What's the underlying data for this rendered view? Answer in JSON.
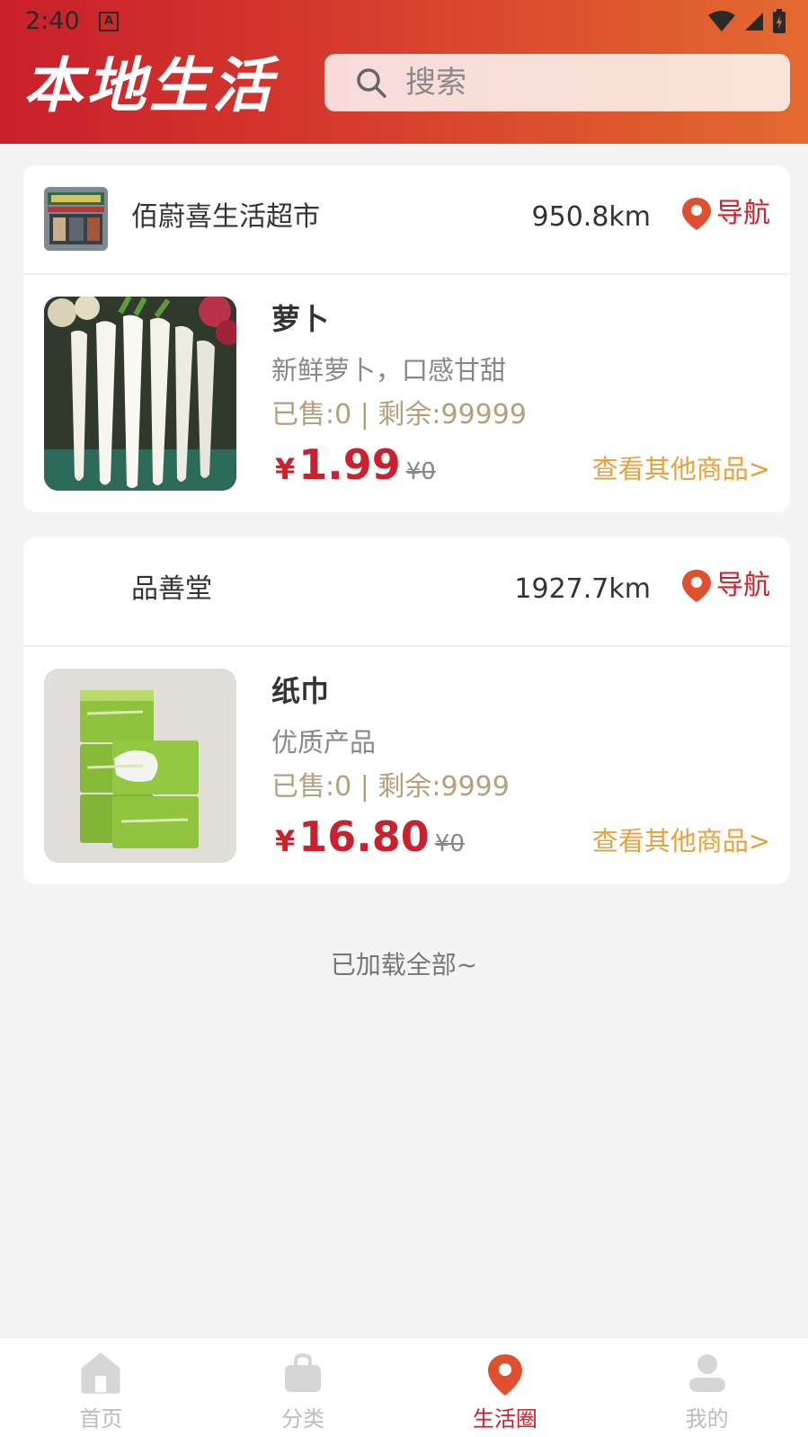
{
  "status_bar": {
    "time": "2:40",
    "notification_icon": "A"
  },
  "header": {
    "title": "本地生活",
    "search_placeholder": "搜索"
  },
  "stores": [
    {
      "name": "佰蔚喜生活超市",
      "distance": "950.8km",
      "nav_label": "导航",
      "product": {
        "name": "萝卜",
        "desc": "新鲜萝卜，口感甘甜",
        "stock": "已售:0 | 剩余:99999",
        "price_symbol": "¥",
        "price": "1.99",
        "old_price": "¥0",
        "more": "查看其他商品>"
      }
    },
    {
      "name": "品善堂",
      "distance": "1927.7km",
      "nav_label": "导航",
      "product": {
        "name": "纸巾",
        "desc": "优质产品",
        "stock": "已售:0 | 剩余:9999",
        "price_symbol": "¥",
        "price": "16.80",
        "old_price": "¥0",
        "more": "查看其他商品>"
      }
    }
  ],
  "footer_text": "已加载全部~",
  "tabs": [
    {
      "label": "首页",
      "icon": "home-icon"
    },
    {
      "label": "分类",
      "icon": "bag-icon"
    },
    {
      "label": "生活圈",
      "icon": "location-pin-icon",
      "active": true
    },
    {
      "label": "我的",
      "icon": "user-icon"
    }
  ],
  "colors": {
    "brand_red": "#c9222e",
    "link_orange": "#e6a23c",
    "stock_tan": "#b4a07a"
  }
}
